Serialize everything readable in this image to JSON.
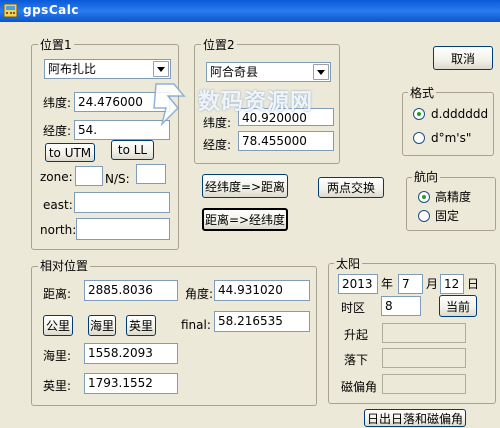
{
  "window": {
    "title": "gpsCalc"
  },
  "pos1": {
    "group_label": "位置1",
    "location": "阿布扎比",
    "lat_label": "纬度:",
    "lat": "24.476000",
    "lon_label": "经度:",
    "lon": "54.",
    "to_utm": "to UTM",
    "to_ll": "to LL",
    "zone_label": "zone:",
    "zone": "",
    "ns_label": "N/S:",
    "ns": "",
    "east_label": "east:",
    "east": "",
    "north_label": "north:",
    "north": ""
  },
  "pos2": {
    "group_label": "位置2",
    "location": "阿合奇县",
    "lat_label": "纬度:",
    "lat": "40.920000",
    "lon_label": "经度:",
    "lon": "78.455000"
  },
  "buttons": {
    "cancel": "取消",
    "latlon_to_dist": "经纬度=>距离",
    "swap": "两点交换",
    "dist_to_latlon": "距离=>经纬度",
    "sunrise_sunset": "日出日落和磁偏角",
    "now": "当前"
  },
  "format": {
    "group_label": "格式",
    "options": [
      "d.dddddd",
      "d°m's\""
    ],
    "selected": 0
  },
  "heading": {
    "group_label": "航向",
    "options": [
      "高精度",
      "固定"
    ],
    "selected": 0
  },
  "relative": {
    "group_label": "相对位置",
    "dist_label": "距离:",
    "dist": "2885.8036",
    "angle_label": "角度:",
    "angle": "44.931020",
    "final_label": "final:",
    "final": "58.216535",
    "unit_km": "公里",
    "unit_nm": "海里",
    "unit_mi": "英里",
    "nm_label": "海里:",
    "nm": "1558.2093",
    "mi_label": "英里:",
    "mi": "1793.1552"
  },
  "sun": {
    "group_label": "太阳",
    "year": "2013",
    "year_label": "年",
    "month": "7",
    "month_label": "月",
    "day": "12",
    "day_label": "日",
    "tz_label": "时区",
    "tz": "8",
    "rise_label": "升起",
    "rise": "",
    "set_label": "落下",
    "set": "",
    "mag_label": "磁偏角",
    "mag": ""
  },
  "watermark": {
    "text": "数码资源网"
  },
  "colors": {
    "titlebar": "#0a5ad8",
    "window_bg": "#ece9d8",
    "radio_dot": "#21a121"
  }
}
